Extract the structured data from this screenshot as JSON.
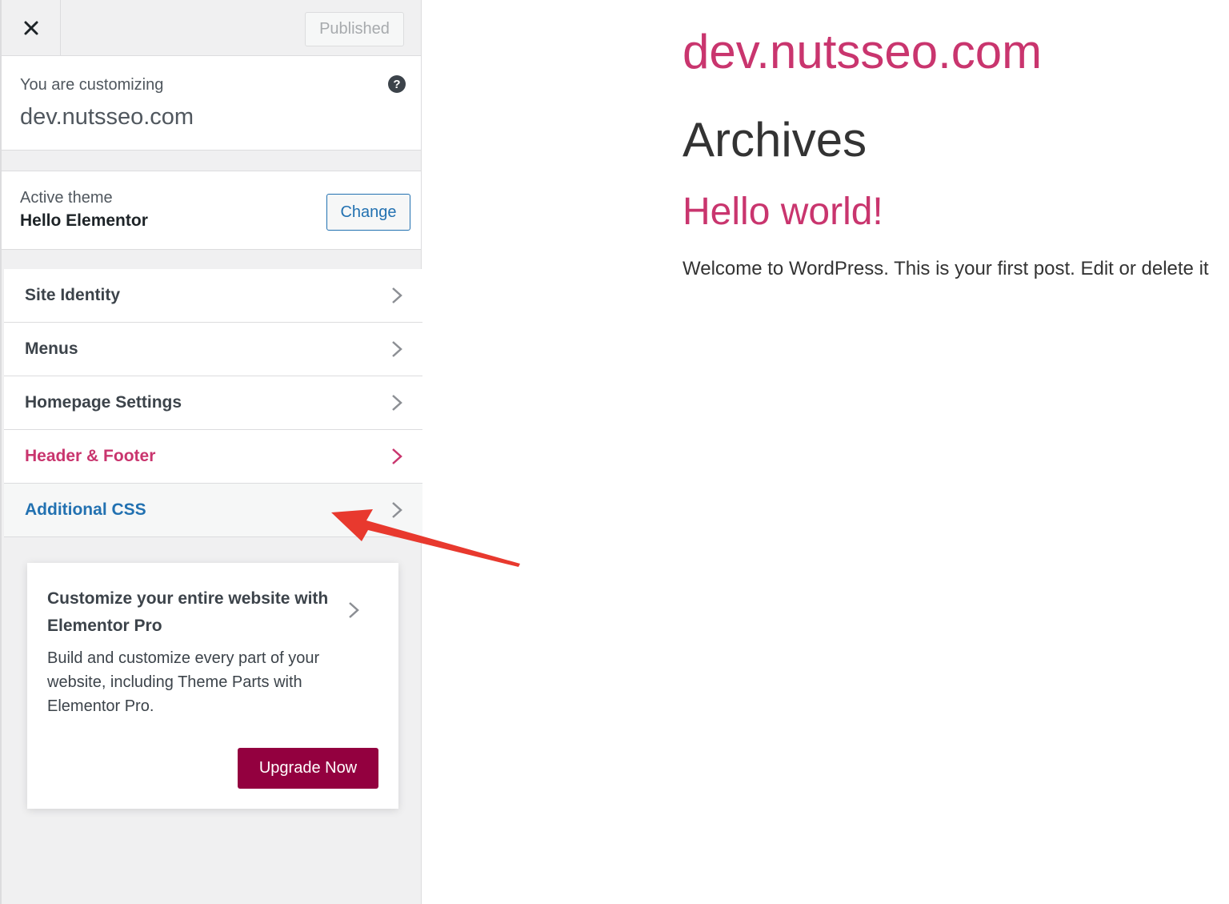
{
  "customizer": {
    "close_icon": "close-icon",
    "published_label": "Published",
    "customizing_label": "You are customizing",
    "site_name": "dev.nutsseo.com",
    "help_icon": "help-icon",
    "active_theme_label": "Active theme",
    "theme_name": "Hello Elementor",
    "change_label": "Change",
    "items": [
      {
        "label": "Site Identity",
        "color": "#3c434a"
      },
      {
        "label": "Menus",
        "color": "#3c434a"
      },
      {
        "label": "Homepage Settings",
        "color": "#3c434a"
      },
      {
        "label": "Header & Footer",
        "color": "#c9356e"
      },
      {
        "label": "Additional CSS",
        "color": "#2271b1"
      }
    ],
    "promo": {
      "title": "Customize your entire website with Elementor Pro",
      "text": "Build and customize every part of your website, including Theme Parts with Elementor Pro.",
      "button_label": "Upgrade Now",
      "button_color": "#93003f"
    }
  },
  "preview": {
    "site_title": "dev.nutsseo.com",
    "page_title": "Archives",
    "post_title": "Hello world!",
    "post_excerpt": "Welcome to WordPress. This is your first post. Edit or delete it",
    "accent_color": "#c9356e"
  },
  "annotation": {
    "arrow_color": "#e8392e"
  }
}
